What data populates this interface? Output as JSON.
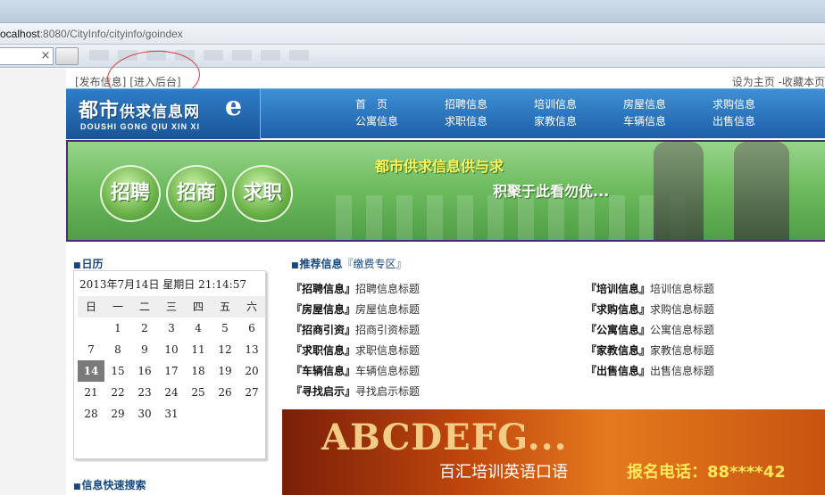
{
  "browser": {
    "url_host": "ocalhost",
    "url_rest": ":8080/CityInfo/cityinfo/goindex",
    "search_close": "×"
  },
  "top_links": {
    "publish": "[发布信息]",
    "admin": "[进入后台]",
    "set_home": "设为主页",
    "separator": "-",
    "bookmark": "收藏本页"
  },
  "logo": {
    "main": "都市",
    "main_small": "供求信息网",
    "e": "e",
    "sub": "DOUSHI  GONG QIU XIN XI"
  },
  "nav": {
    "row1": [
      "首　页",
      "招聘信息",
      "培训信息",
      "房屋信息",
      "求购信息"
    ],
    "row2": [
      "公寓信息",
      "求职信息",
      "家教信息",
      "车辆信息",
      "出售信息"
    ]
  },
  "banner": {
    "pills": [
      "招聘",
      "招商",
      "求职"
    ],
    "slogan_1": "都市供求信息供与求",
    "slogan_2": "积聚于此看勿优..."
  },
  "calendar": {
    "title": "日历",
    "date_line": "2013年7月14日  星期日   21:14:57",
    "weekdays": [
      "日",
      "一",
      "二",
      "三",
      "四",
      "五",
      "六"
    ],
    "today": 14,
    "rows": [
      [
        "",
        "1",
        "2",
        "3",
        "4",
        "5",
        "6"
      ],
      [
        "7",
        "8",
        "9",
        "10",
        "11",
        "12",
        "13"
      ],
      [
        "14",
        "15",
        "16",
        "17",
        "18",
        "19",
        "20"
      ],
      [
        "21",
        "22",
        "23",
        "24",
        "25",
        "26",
        "27"
      ],
      [
        "28",
        "29",
        "30",
        "31",
        "",
        "",
        ""
      ]
    ]
  },
  "quick_search": {
    "title": "信息快速搜索"
  },
  "recommend": {
    "title": "推荐信息",
    "free_zone": "『缴费专区』",
    "items": [
      {
        "cat": "『招聘信息』",
        "text": "招聘信息标题"
      },
      {
        "cat": "『培训信息』",
        "text": "培训信息标题"
      },
      {
        "cat": "『房屋信息』",
        "text": "房屋信息标题"
      },
      {
        "cat": "『求购信息』",
        "text": "求购信息标题"
      },
      {
        "cat": "『招商引资』",
        "text": "招商引资标题"
      },
      {
        "cat": "『公寓信息』",
        "text": "公寓信息标题"
      },
      {
        "cat": "『求职信息』",
        "text": "求职信息标题"
      },
      {
        "cat": "『家教信息』",
        "text": "家教信息标题"
      },
      {
        "cat": "『车辆信息』",
        "text": "车辆信息标题"
      },
      {
        "cat": "『出售信息』",
        "text": "出售信息标题"
      },
      {
        "cat": "『寻找启示』",
        "text": "寻找启示标题"
      }
    ]
  },
  "ad": {
    "big": "ABCDEFG...",
    "line": "百汇培训英语口语",
    "tel": "报名电话：88****42"
  }
}
